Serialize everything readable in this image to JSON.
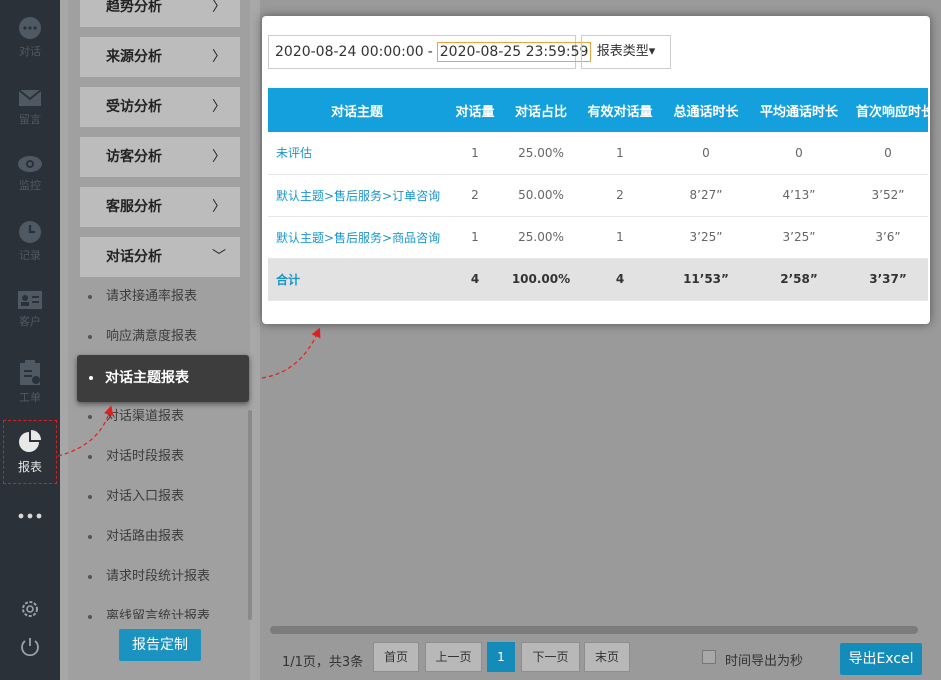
{
  "rail": {
    "items": [
      {
        "label": "对话",
        "icon": "chat-icon"
      },
      {
        "label": "留言",
        "icon": "mail-icon"
      },
      {
        "label": "监控",
        "icon": "eye-icon"
      },
      {
        "label": "记录",
        "icon": "clock-icon"
      },
      {
        "label": "客户",
        "icon": "contact-card-icon"
      },
      {
        "label": "工单",
        "icon": "clipboard-icon"
      },
      {
        "label": "报表",
        "icon": "pie-chart-icon"
      }
    ]
  },
  "submenu": {
    "groups": [
      "趋势分析",
      "来源分析",
      "受访分析",
      "访客分析",
      "客服分析",
      "对话分析"
    ],
    "items": [
      "请求接通率报表",
      "响应满意度报表",
      "对话主题报表",
      "对话渠道报表",
      "对话时段报表",
      "对话入口报表",
      "对话路由报表",
      "请求时段统计报表",
      "离线留言统计报表"
    ],
    "active": "对话主题报表",
    "custom_button": "报告定制"
  },
  "filter": {
    "date_start": "2020-08-24 00:00:00",
    "date_sep": "-",
    "date_end": "2020-08-25 23:59:59",
    "type_button": "报表类型▾"
  },
  "table": {
    "headers": [
      "对话主题",
      "对话量",
      "对话占比",
      "有效对话量",
      "总通话时长",
      "平均通话时长",
      "首次响应时长"
    ],
    "rows": [
      [
        "未评估",
        "1",
        "25.00%",
        "1",
        "0",
        "0",
        "0"
      ],
      [
        "默认主题>售后服务>订单咨询",
        "2",
        "50.00%",
        "2",
        "8’27”",
        "4’13”",
        "3’52”"
      ],
      [
        "默认主题>售后服务>商品咨询",
        "1",
        "25.00%",
        "1",
        "3’25”",
        "3’25”",
        "3’6”"
      ]
    ],
    "total": [
      "合计",
      "4",
      "100.00%",
      "4",
      "11’53”",
      "2’58”",
      "3’37”"
    ]
  },
  "pagination": {
    "info": "1/1页，共3条",
    "first": "首页",
    "prev": "上一页",
    "current": "1",
    "next": "下一页",
    "last": "末页"
  },
  "export": {
    "checkbox_label": "时间导出为秒",
    "button": "导出Excel"
  },
  "colors": {
    "accent": "#14a0dc",
    "rail_bg": "#2b3138",
    "annotation": "#e02020"
  }
}
